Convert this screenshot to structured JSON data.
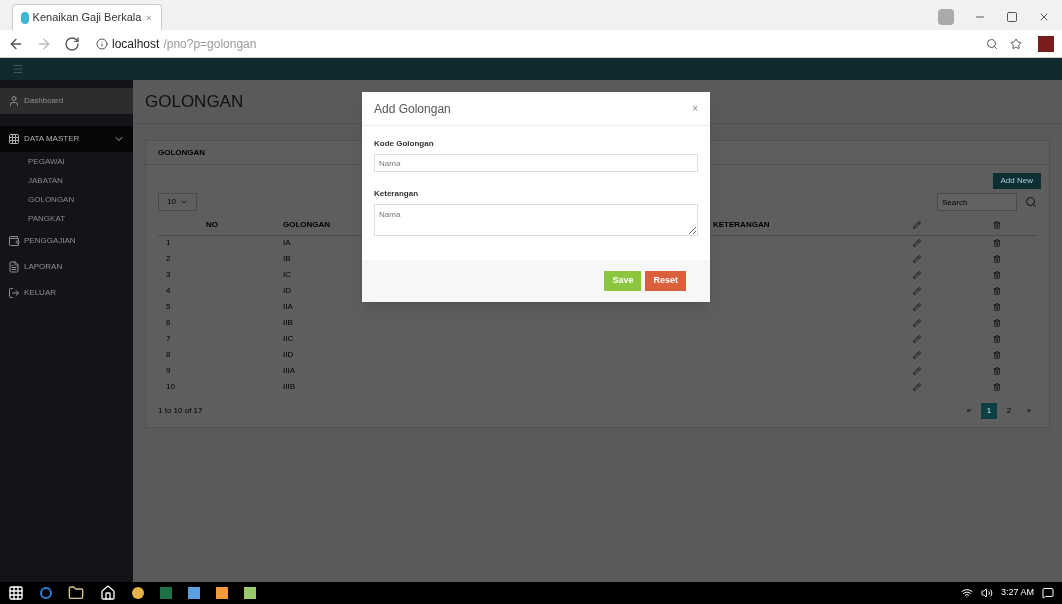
{
  "browser": {
    "tab_title": "Kenaikan Gaji Berkala",
    "url_host": "localhost",
    "url_path": "/pno?p=golongan"
  },
  "sidebar": {
    "items": [
      {
        "label": "Dashboard",
        "selected": false
      },
      {
        "label": "DATA MASTER",
        "selected": true,
        "children": [
          {
            "label": "PEGAWAI"
          },
          {
            "label": "JABATAN"
          },
          {
            "label": "GOLONGAN"
          },
          {
            "label": "PANGKAT"
          }
        ]
      },
      {
        "label": "PENGGAJIAN",
        "selected": false
      },
      {
        "label": "LAPORAN",
        "selected": false
      },
      {
        "label": "KELUAR",
        "selected": false
      }
    ]
  },
  "page": {
    "heading": "GOLONGAN",
    "panel_title": "GOLONGAN",
    "add_button": "Add New",
    "entries": "10",
    "search_placeholder": "Search",
    "table": {
      "columns": [
        "NO",
        "GOLONGAN",
        "KETERANGAN"
      ],
      "rows": [
        [
          "1",
          "IA"
        ],
        [
          "2",
          "IB"
        ],
        [
          "3",
          "IC"
        ],
        [
          "4",
          "ID"
        ],
        [
          "5",
          "IIA"
        ],
        [
          "6",
          "IIB"
        ],
        [
          "7",
          "IIC"
        ],
        [
          "8",
          "IID"
        ],
        [
          "9",
          "IIIA"
        ],
        [
          "10",
          "IIIB"
        ]
      ]
    },
    "info": "1 to 10 of 17",
    "pages": [
      {
        "label": "«",
        "selected": false
      },
      {
        "label": "1",
        "selected": true
      },
      {
        "label": "2",
        "selected": false
      },
      {
        "label": "»",
        "selected": false
      }
    ]
  },
  "modal": {
    "title": "Add Golongan",
    "close": "×",
    "fields": [
      {
        "label": "Kode Golongan",
        "placeholder": "Nama",
        "kind": "input"
      },
      {
        "label": "Keterangan",
        "placeholder": "Nama",
        "kind": "textarea"
      }
    ],
    "buttons": [
      {
        "label": "Save",
        "kind": "save"
      },
      {
        "label": "Reset",
        "kind": "reset"
      }
    ]
  },
  "taskbar": {
    "time": "3:27 AM"
  }
}
